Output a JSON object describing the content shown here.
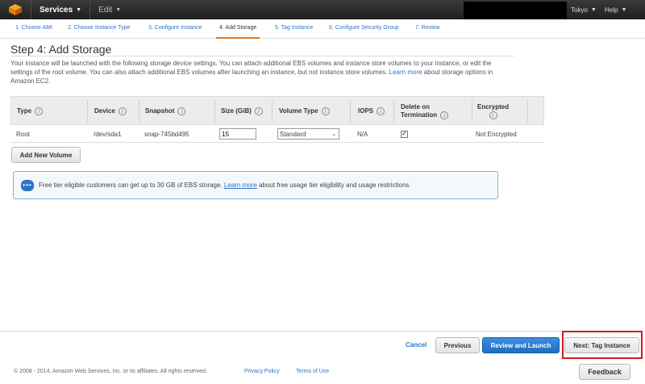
{
  "nav": {
    "services_label": "Services",
    "edit_label": "Edit",
    "region_label": "Tokyo",
    "help_label": "Help"
  },
  "wizard": {
    "tabs": [
      {
        "label": "1. Choose AMI"
      },
      {
        "label": "2. Choose Instance Type"
      },
      {
        "label": "3. Configure Instance"
      },
      {
        "label": "4. Add Storage",
        "active": true
      },
      {
        "label": "5. Tag Instance"
      },
      {
        "label": "6. Configure Security Group"
      },
      {
        "label": "7. Review"
      }
    ]
  },
  "page": {
    "title": "Step 4: Add Storage",
    "description": "Your instance will be launched with the following storage device settings. You can attach additional EBS volumes and instance store volumes to your instance, or edit the settings of the root volume. You can also attach additional EBS volumes after launching an instance, but not instance store volumes.",
    "learn_more": "Learn more",
    "description_tail": "about storage options in Amazon EC2."
  },
  "table": {
    "headers": {
      "type": "Type",
      "device": "Device",
      "snapshot": "Snapshot",
      "size": "Size (GiB)",
      "volume_type": "Volume Type",
      "iops": "IOPS",
      "delete_line1": "Delete on",
      "delete_line2": "Termination",
      "encrypted": "Encrypted"
    },
    "row": {
      "type": "Root",
      "device": "/dev/sda1",
      "snapshot": "snap-745bd495",
      "size": "15",
      "volume_type": "Standard",
      "iops": "N/A",
      "delete_on_termination": true,
      "encrypted": "Not Encrypted"
    },
    "add_volume_label": "Add New Volume"
  },
  "notice": {
    "text_before": "Free tier eligible customers can get up to 30 GB of EBS storage.",
    "link": "Learn more",
    "text_after": "about free usage tier eligibility and usage restrictions."
  },
  "footer_actions": {
    "cancel": "Cancel",
    "previous": "Previous",
    "review_launch": "Review and Launch",
    "next": "Next: Tag Instance"
  },
  "footer": {
    "copyright": "© 2008 - 2014, Amazon Web Services, Inc. or its affiliates. All rights reserved.",
    "privacy": "Privacy Policy",
    "terms": "Terms of Use",
    "feedback": "Feedback"
  },
  "colors": {
    "nav_bg": "#232323",
    "link": "#2a74c9",
    "active_tab": "#e0781d",
    "primary_button": "#2a74c9",
    "highlight_box": "#d01c1c"
  }
}
